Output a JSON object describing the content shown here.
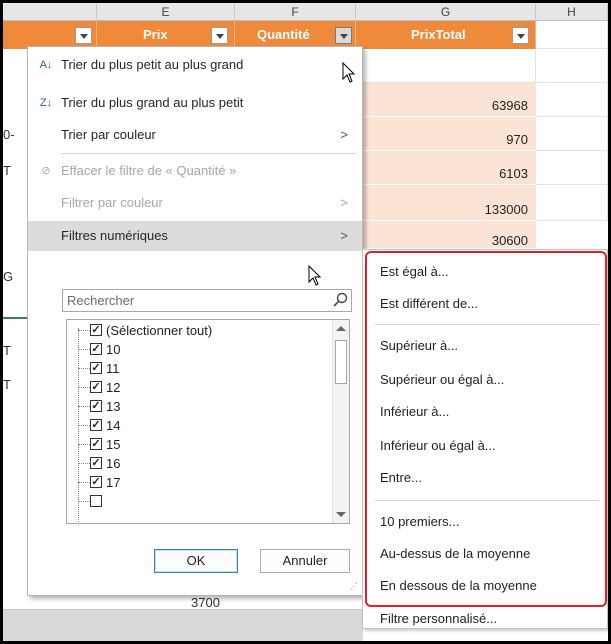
{
  "columns": [
    {
      "letter": "E"
    },
    {
      "letter": "F"
    },
    {
      "letter": "G"
    },
    {
      "letter": "H"
    }
  ],
  "table_header": {
    "prix": "Prix",
    "quantite": "Quantité",
    "prix_total": "PrixTotal"
  },
  "prix_total_values": [
    "63968",
    "970",
    "6103",
    "133000",
    "30600"
  ],
  "row_fragments": [
    "0-",
    "T",
    "G",
    "T",
    "T"
  ],
  "hidden_cell_value": "3700",
  "menu": {
    "sort_asc": "Trier du plus petit au plus grand",
    "sort_desc": "Trier du plus grand au plus petit",
    "sort_by_color": "Trier par couleur",
    "clear_filter": "Effacer le filtre de « Quantité »",
    "filter_by_color": "Filtrer par couleur",
    "number_filters": "Filtres numériques",
    "search_placeholder": "Rechercher",
    "ok": "OK",
    "cancel": "Annuler"
  },
  "checklist": [
    {
      "label": "(Sélectionner tout)",
      "checked": true
    },
    {
      "label": "10",
      "checked": true
    },
    {
      "label": "11",
      "checked": true
    },
    {
      "label": "12",
      "checked": true
    },
    {
      "label": "13",
      "checked": true
    },
    {
      "label": "14",
      "checked": true
    },
    {
      "label": "15",
      "checked": true
    },
    {
      "label": "16",
      "checked": true
    },
    {
      "label": "17",
      "checked": true
    }
  ],
  "submenu": [
    "Est égal à...",
    "Est différent de...",
    "Supérieur à...",
    "Supérieur ou égal à...",
    "Inférieur à...",
    "Inférieur ou égal à...",
    "Entre...",
    "10 premiers...",
    "Au-dessus de la moyenne",
    "En dessous de la moyenne",
    "Filtre personnalisé..."
  ],
  "colors": {
    "header_orange": "#ef8a3a",
    "row_peach": "#fbe4d5",
    "highlight_red": "#e0202a"
  }
}
